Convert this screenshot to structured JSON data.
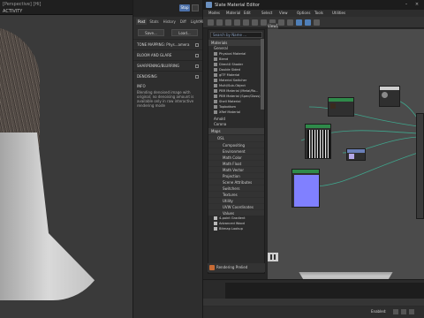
{
  "viewport": {
    "top_label": "[Perspective] [Hi]",
    "mode_label": "ACTIVITY",
    "mode_label2": "ACTIVITY"
  },
  "render_panel": {
    "stop_label": "Stop",
    "tabs": [
      "Post",
      "Stats",
      "History",
      "Diff",
      "LightMix"
    ],
    "save_label": "Save...",
    "load_label": "Load...",
    "sections": [
      "TONE MAPPING: Phys...amera",
      "BLOOM AND GLARE",
      "SHARPENING/BLURRING",
      "DENOISING"
    ],
    "info_heading": "INFO",
    "info_text": "Blending denoised image with original; no denoising amount is available only in raw interactive rendering mode"
  },
  "slate": {
    "title": "Slate Material Editor",
    "menu": [
      "Modes",
      "Material",
      "Edit",
      "Select",
      "View",
      "Options",
      "Tools",
      "Utilities"
    ],
    "view_tab": "View1",
    "search_placeholder": "Search by Name ...",
    "materials_header": "Materials",
    "general_header": "General",
    "materials": [
      "Physical Material",
      "Blend",
      "DirectX Shader",
      "Double Sided",
      "glTF Material",
      "Material Switcher",
      "Multi/Sub-Object",
      "PBR Material (Metal/Ro...",
      "PBR Material (Spec/Gloss)",
      "Shell Material",
      "Topbottom",
      "XRef Material"
    ],
    "arnold_label": "Arnold",
    "corona_label": "Corona",
    "maps_header": "Maps",
    "osl_label": "OSL",
    "map_groups": [
      "Compositing",
      "Environment",
      "Math Color",
      "Math Float",
      "Math Vector",
      "Projection",
      "Scene Attributes",
      "Switchers",
      "Textures",
      "Utility",
      "UVW Coordinates",
      "Values"
    ],
    "map_leaves": [
      "Bitmap",
      "Advanced Wood",
      "Bitmap Lookup"
    ],
    "first_leaf": "4-point Gradient",
    "status_label": "Rendering Prelied",
    "enabled_label": "Enabled:"
  }
}
